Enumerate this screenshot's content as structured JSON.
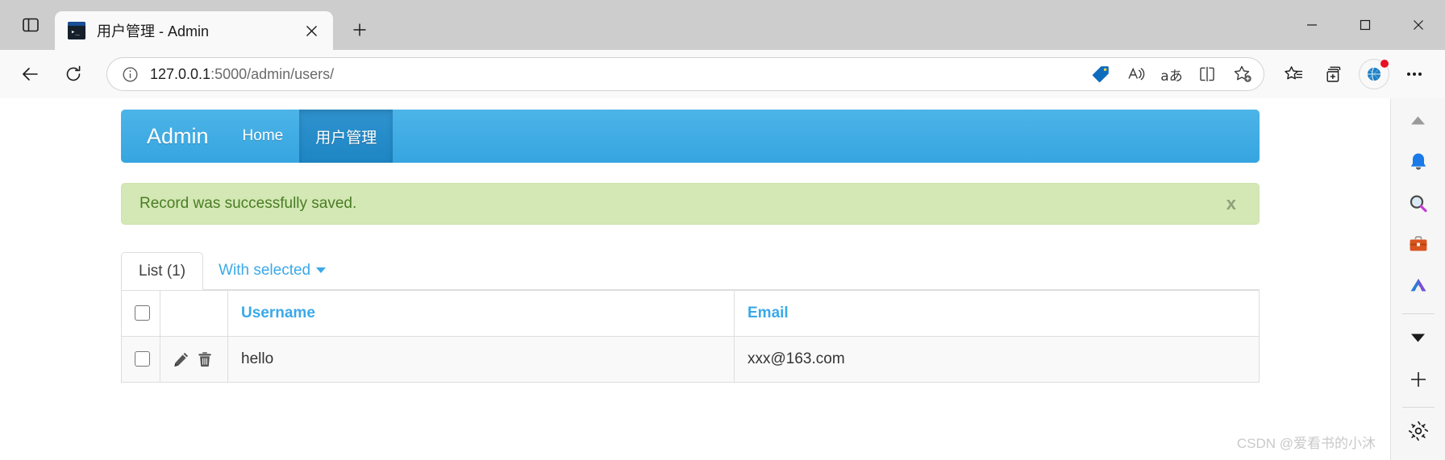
{
  "window": {
    "minimize_label": "Minimize",
    "maximize_label": "Maximize",
    "close_label": "Close"
  },
  "browser": {
    "sidebar_toggle_name": "tab-actions-icon",
    "tab": {
      "title": "用户管理 - Admin",
      "favicon_glyph": "▸_",
      "close_label": "×"
    },
    "new_tab_label": "+",
    "back_label": "Back",
    "refresh_label": "Refresh",
    "omnibox": {
      "url_main": "127.0.0.1",
      "url_rest": ":5000/admin/users/",
      "info_icon": "info-icon"
    },
    "omni_actions": [
      {
        "name": "shopping-tag-icon",
        "label": "Shopping"
      },
      {
        "name": "read-aloud-icon",
        "label": "Read aloud"
      },
      {
        "name": "translate-icon",
        "label": "Translate",
        "text": "aあ"
      },
      {
        "name": "split-screen-icon",
        "label": "Split screen"
      },
      {
        "name": "add-favorite-icon",
        "label": "Add this page to favorites"
      }
    ],
    "toolbar_right": [
      {
        "name": "favorites-icon",
        "label": "Favorites"
      },
      {
        "name": "collections-icon",
        "label": "Collections"
      },
      {
        "name": "copilot-icon",
        "label": "Copilot"
      },
      {
        "name": "settings-and-more-icon",
        "label": "Settings and more"
      }
    ]
  },
  "edge_sidebar": {
    "items": [
      {
        "name": "sidebar-scroll-up-icon",
        "label": "Scroll up"
      },
      {
        "name": "notifications-bell-icon",
        "label": "Notifications"
      },
      {
        "name": "search-magnifier-icon",
        "label": "Search"
      },
      {
        "name": "tools-briefcase-icon",
        "label": "Tools"
      },
      {
        "name": "app-shortcut-icon",
        "label": "App"
      },
      {
        "name": "sidebar-scroll-down-icon",
        "label": "Scroll down"
      },
      {
        "name": "add-sidebar-app-icon",
        "label": "Customize"
      },
      {
        "name": "sidebar-settings-gear-icon",
        "label": "Sidebar settings"
      }
    ]
  },
  "page": {
    "navbar": {
      "brand": "Admin",
      "links": [
        {
          "label": "Home",
          "active": false
        },
        {
          "label": "用户管理",
          "active": true
        }
      ]
    },
    "alert": {
      "message": "Record was successfully saved.",
      "close_label": "x"
    },
    "tabs": [
      {
        "label": "List (1)",
        "active": true
      }
    ],
    "with_selected": {
      "label": "With selected",
      "caret": "▾"
    },
    "table": {
      "columns": [
        {
          "key": "check",
          "label": ""
        },
        {
          "key": "ops",
          "label": ""
        },
        {
          "key": "username",
          "label": "Username"
        },
        {
          "key": "email",
          "label": "Email"
        }
      ],
      "rows": [
        {
          "username": "hello",
          "email": "xxx@163.com",
          "edit_label": "Edit record",
          "delete_label": "Delete record"
        }
      ]
    }
  },
  "watermark": "CSDN @爱看书的小沐"
}
